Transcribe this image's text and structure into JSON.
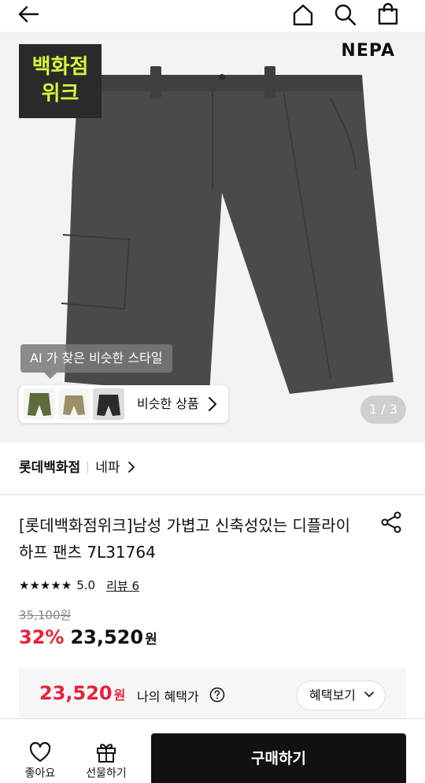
{
  "header": {
    "back_icon": "arrow-left-icon",
    "home_icon": "home-icon",
    "search_icon": "search-icon",
    "cart_icon": "shopping-bag-icon"
  },
  "hero": {
    "brand_logo": "NEPA",
    "promo_badge": [
      "백화점",
      "위크"
    ],
    "ai_tooltip": "AI 가 찾은 비슷한 스타일",
    "similar_label": "비슷한 상품",
    "page_indicator": "1 / 3",
    "product_color": "#4a4a4c",
    "badge_text_color": "#d8f53a"
  },
  "store": {
    "name": "롯데백화점",
    "brand": "네파"
  },
  "product": {
    "title": "[롯데백화점위크]남성 가볍고 신축성있는 디플라이 하프 팬츠 7L31764",
    "rating_stars": "★★★★★",
    "rating": "5.0",
    "review_link": "리뷰 6",
    "original_price": "35,100원",
    "discount": "32%",
    "sale_price": "23,520",
    "won": "원"
  },
  "benefit": {
    "price": "23,520",
    "won": "원",
    "label": "나의 혜택가",
    "button": "혜택보기"
  },
  "bottom": {
    "like_label": "좋아요",
    "gift_label": "선물하기",
    "buy_label": "구매하기"
  },
  "colors": {
    "accent_red": "#e6213c",
    "buy_button": "#111111"
  }
}
